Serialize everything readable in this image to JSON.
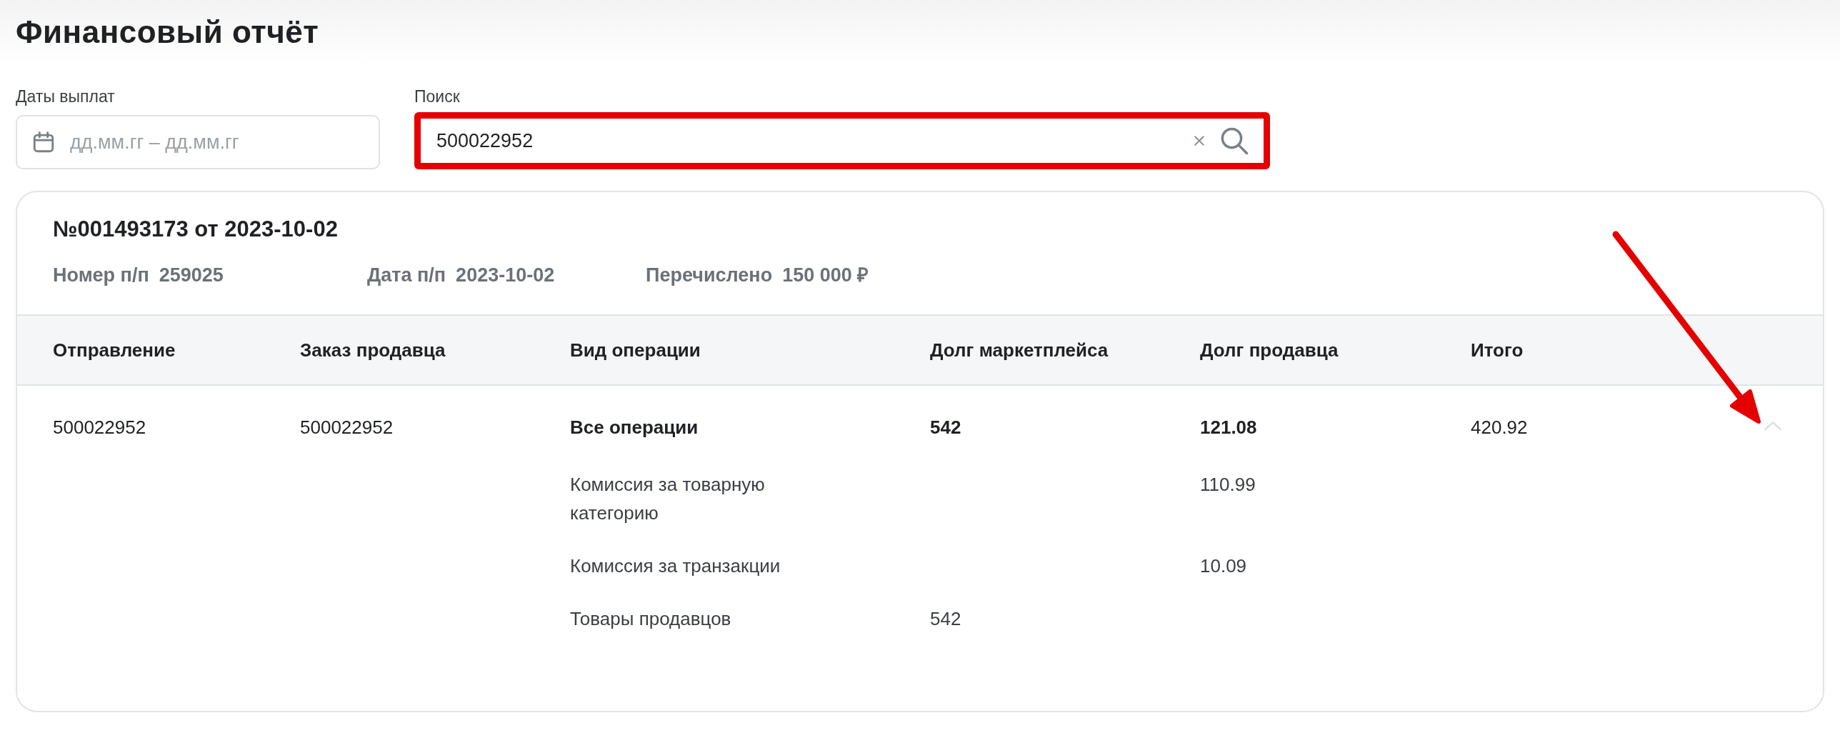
{
  "page": {
    "title": "Финансовый отчёт"
  },
  "filters": {
    "dates": {
      "label": "Даты выплат",
      "placeholder": "дд.мм.гг – дд.мм.гг"
    },
    "search": {
      "label": "Поиск",
      "value": "500022952",
      "highlighted": true
    }
  },
  "report": {
    "title": "№001493173 от 2023-10-02",
    "meta": [
      {
        "label": "Номер п/п",
        "value": "259025"
      },
      {
        "label": "Дата п/п",
        "value": "2023-10-02"
      },
      {
        "label": "Перечислено",
        "value": "150 000 ₽"
      }
    ],
    "table": {
      "columns": [
        "Отправление",
        "Заказ продавца",
        "Вид операции",
        "Долг маркетплейса",
        "Долг продавца",
        "Итого"
      ],
      "rows": [
        {
          "cells": [
            "500022952",
            "500022952",
            "Все операции",
            "542",
            "121.08",
            "420.92"
          ],
          "expanded": true,
          "details": [
            {
              "operation": "Комиссия за товарную категорию",
              "seller_debt": "110.99"
            },
            {
              "operation": "Комиссия за транзакции",
              "seller_debt": "10.09"
            },
            {
              "operation": "Товары продавцов",
              "marketplace_debt": "542"
            }
          ]
        }
      ]
    }
  }
}
